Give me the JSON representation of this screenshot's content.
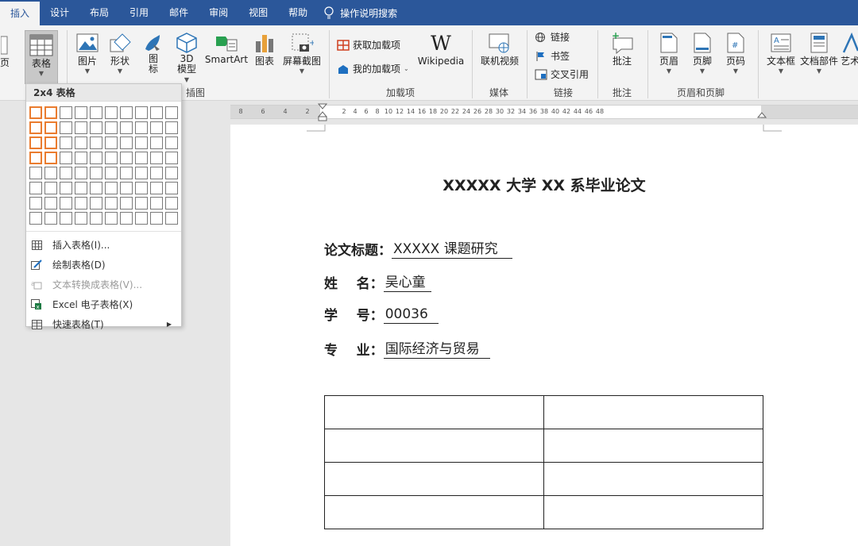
{
  "tabs": [
    "插入",
    "设计",
    "布局",
    "引用",
    "邮件",
    "审阅",
    "视图",
    "帮助"
  ],
  "tell_me": "操作说明搜索",
  "ribbon": {
    "left_stub": "页",
    "table_btn": "表格",
    "picture": "图片",
    "shapes": "形状",
    "icons1": "图",
    "icons2": "标",
    "model1": "3D",
    "model2": "模型",
    "smartart": "SmartArt",
    "chart": "图表",
    "screenshot": "屏幕截图",
    "group_illustrations": "插图",
    "get_addins": "获取加载项",
    "my_addins": "我的加载项",
    "wikipedia": "Wikipedia",
    "group_addins": "加载项",
    "online_video": "联机视频",
    "group_media": "媒体",
    "link": "链接",
    "bookmark": "书签",
    "crossref": "交叉引用",
    "group_links": "链接",
    "comment": "批注",
    "group_comments": "批注",
    "header": "页眉",
    "footer": "页脚",
    "page_number": "页码",
    "group_hf": "页眉和页脚",
    "textbox": "文本框",
    "quickparts": "文档部件",
    "wordart": "艺术"
  },
  "dropdown": {
    "title": "2x4 表格",
    "grid_cols": 10,
    "grid_rows": 8,
    "sel_cols": 2,
    "sel_rows": 4,
    "items": [
      {
        "label": "插入表格(I)...",
        "disabled": false
      },
      {
        "label": "绘制表格(D)",
        "disabled": false
      },
      {
        "label": "文本转换成表格(V)...",
        "disabled": true
      },
      {
        "label": "Excel 电子表格(X)",
        "disabled": false
      },
      {
        "label": "快速表格(T)",
        "disabled": false
      }
    ]
  },
  "ruler": {
    "left_ticks": [
      "8",
      "6",
      "4",
      "2"
    ],
    "right_ticks": [
      "2",
      "4",
      "6",
      "8",
      "10",
      "12",
      "14",
      "16",
      "18",
      "20",
      "22",
      "24",
      "26",
      "28",
      "30",
      "32",
      "34",
      "36",
      "38",
      "40",
      "42",
      "44",
      "46",
      "48"
    ]
  },
  "document": {
    "title": "XXXXX 大学 XX 系毕业论文",
    "fields": [
      {
        "label": "论文标题：",
        "value": "XXXXX 课题研究   "
      },
      {
        "label": "姓    名：",
        "value": "吴心童 "
      },
      {
        "label": "学    号：",
        "value": "00036  "
      },
      {
        "label": "专    业：",
        "value": "国际经济与贸易  "
      }
    ],
    "table_rows": 4,
    "table_cols": 2
  },
  "colors": {
    "tabbar": "#2b579a",
    "selection": "#ea7c2f"
  }
}
